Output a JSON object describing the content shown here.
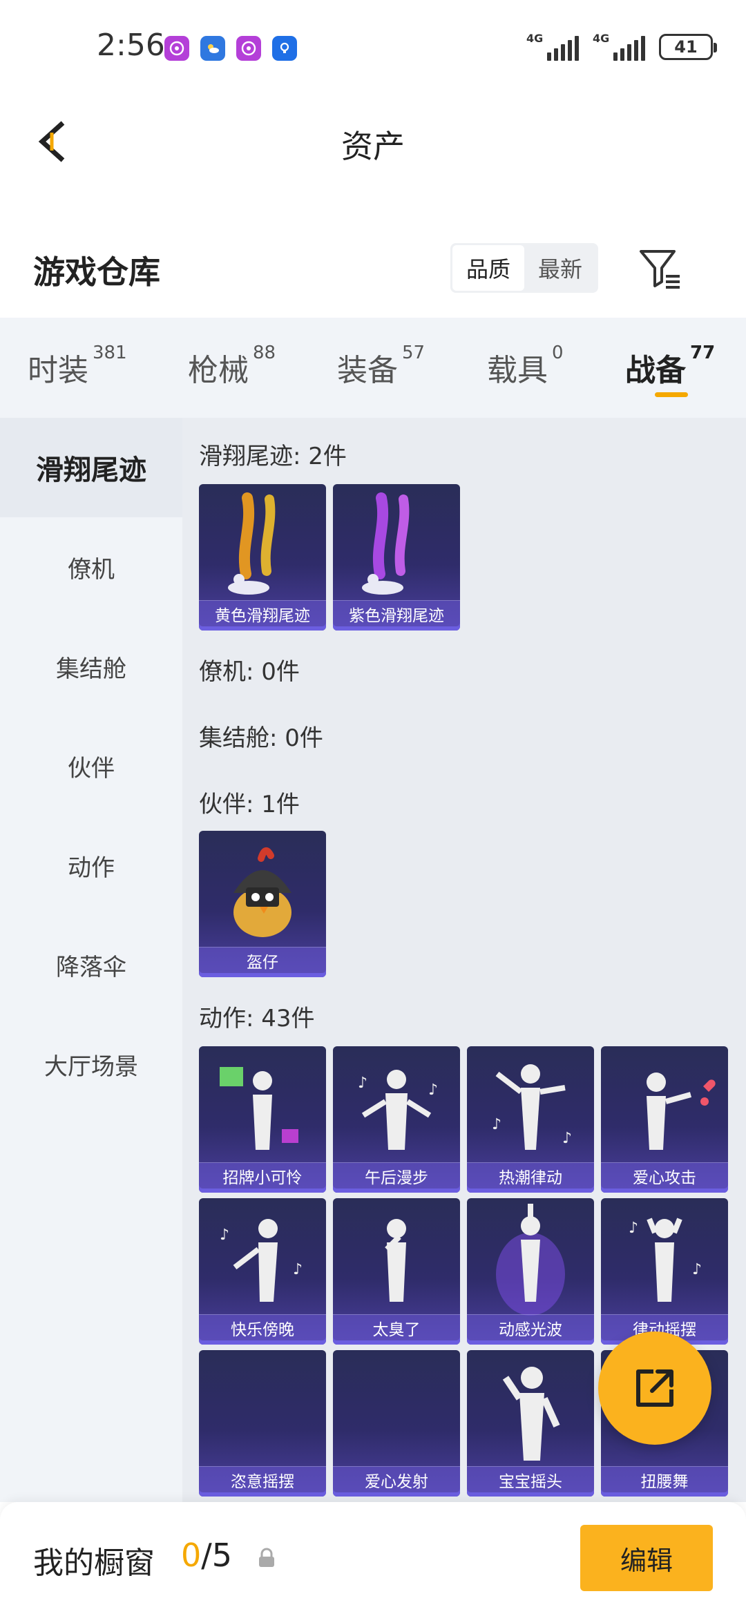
{
  "status_bar": {
    "time": "2:56",
    "network_1": "4G",
    "network_2": "4G",
    "battery": "41",
    "app_icons": [
      "purple-app-icon",
      "weather-icon",
      "purple-app-icon",
      "bulb-icon"
    ]
  },
  "header": {
    "title": "资产",
    "back_icon": "back-arrow-icon"
  },
  "warehouse": {
    "title": "游戏仓库",
    "sort_options": [
      "品质",
      "最新"
    ],
    "active_sort": "品质",
    "filter_icon": "filter-icon"
  },
  "tabs": [
    {
      "label": "时装",
      "count": "381"
    },
    {
      "label": "枪械",
      "count": "88"
    },
    {
      "label": "装备",
      "count": "57"
    },
    {
      "label": "载具",
      "count": "0"
    },
    {
      "label": "战备",
      "count": "77"
    }
  ],
  "active_tab": "战备",
  "sidebar": {
    "items": [
      "滑翔尾迹",
      "僚机",
      "集结舱",
      "伙伴",
      "动作",
      "降落伞",
      "大厅场景"
    ],
    "active": "滑翔尾迹"
  },
  "sections": {
    "glide": {
      "title": "滑翔尾迹: 2件",
      "items": [
        "黄色滑翔尾迹",
        "紫色滑翔尾迹"
      ]
    },
    "wingman": {
      "title": "僚机: 0件"
    },
    "capsule": {
      "title": "集结舱: 0件"
    },
    "partner": {
      "title": "伙伴: 1件",
      "items": [
        "盔仔"
      ]
    },
    "emote": {
      "title": "动作: 43件",
      "items": [
        "招牌小可怜",
        "午后漫步",
        "热潮律动",
        "爱心攻击",
        "快乐傍晚",
        "太臭了",
        "动感光波",
        "律动摇摆",
        "恣意摇摆",
        "爱心发射",
        "宝宝摇头",
        "扭腰舞"
      ]
    }
  },
  "fab": {
    "icon": "share-icon"
  },
  "bottom_bar": {
    "label": "我的橱窗",
    "count_current": "0",
    "count_total": "/5",
    "lock_icon": "lock-icon",
    "edit_label": "编辑"
  },
  "colors": {
    "accent": "#f5a800",
    "button_yellow": "#fbb21e",
    "card_bg": "#2f2c6a",
    "tab_bg": "#f1f4f8",
    "content_bg": "#e9ecf1"
  }
}
